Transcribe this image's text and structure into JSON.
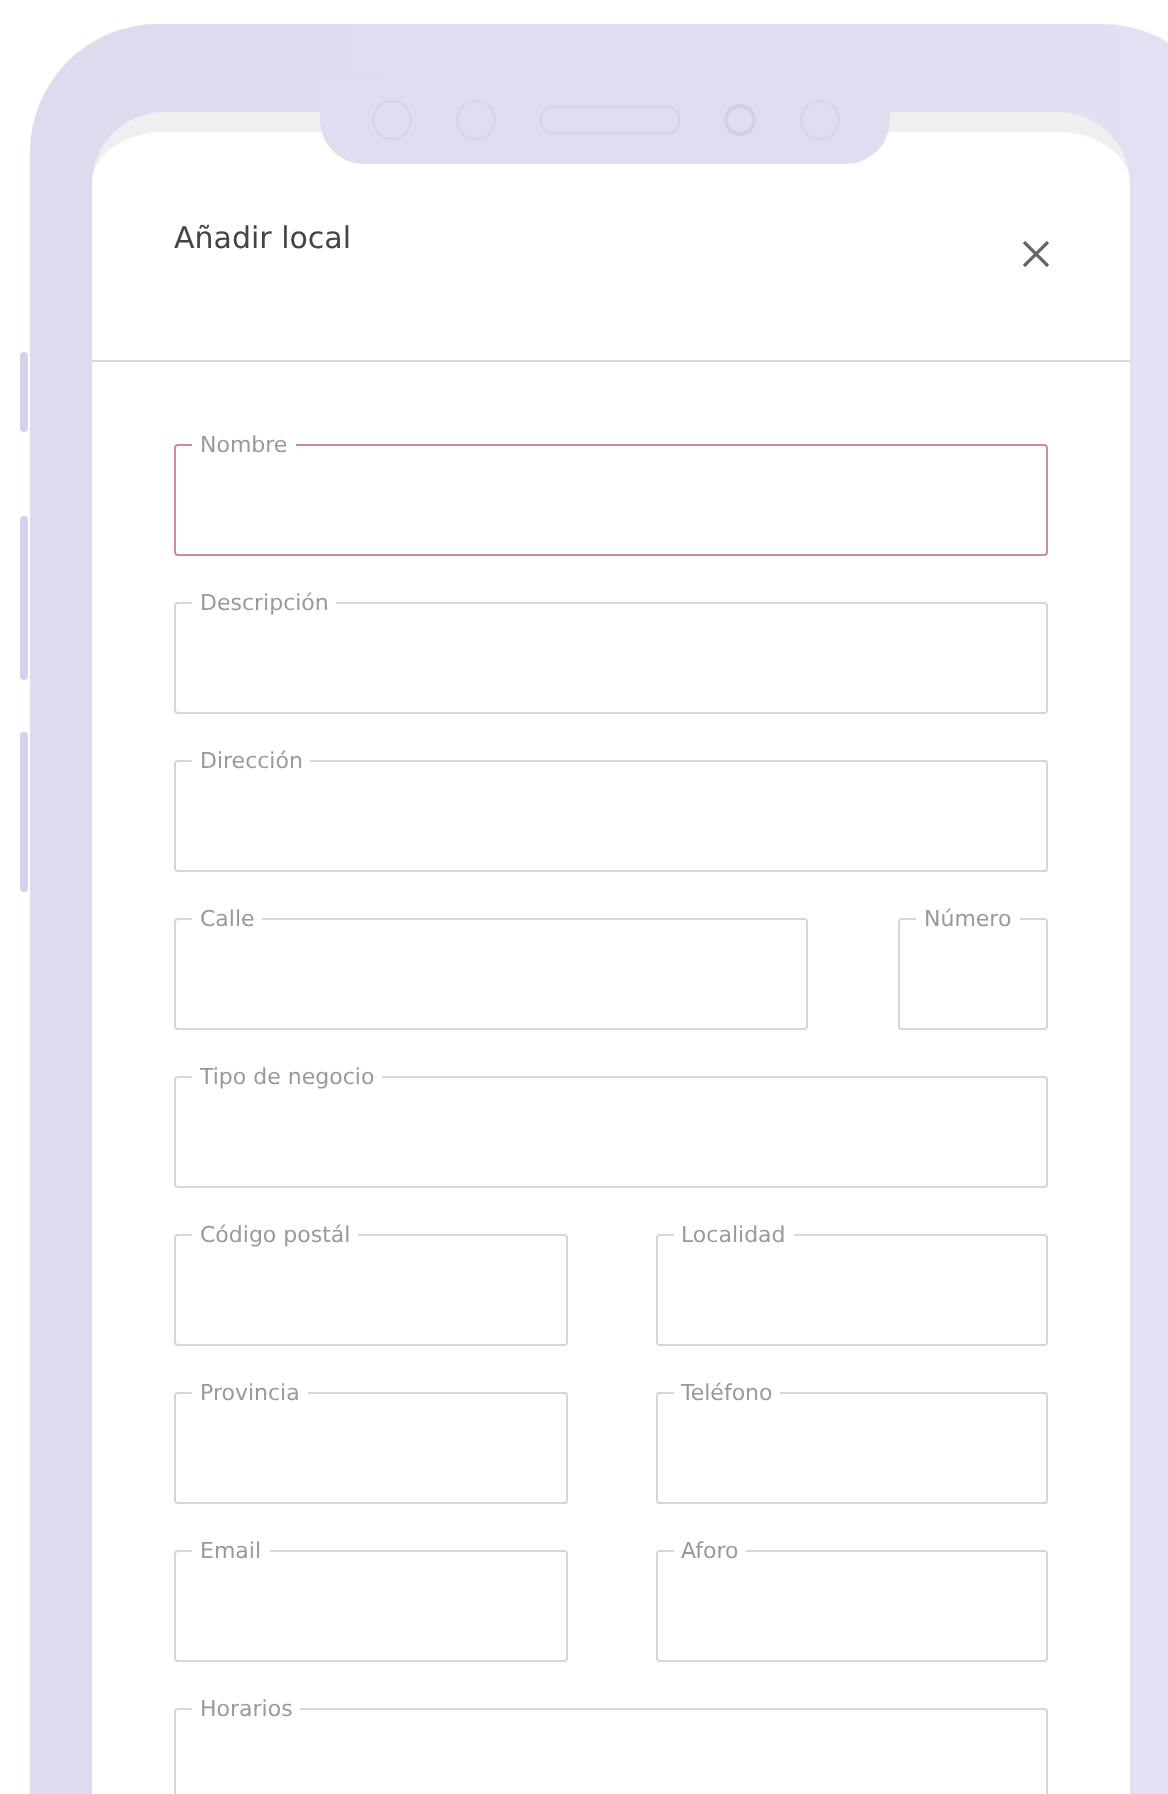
{
  "dialog": {
    "title": "Añadir local"
  },
  "rows": [
    {
      "kind": "single",
      "fields": [
        {
          "label": "Nombre",
          "active": true
        }
      ]
    },
    {
      "kind": "single",
      "fields": [
        {
          "label": "Descripción",
          "active": false
        }
      ]
    },
    {
      "kind": "single",
      "fields": [
        {
          "label": "Dirección",
          "active": false
        }
      ]
    },
    {
      "kind": "street",
      "fields": [
        {
          "label": "Calle",
          "active": false
        },
        {
          "label": "Número",
          "active": false
        }
      ]
    },
    {
      "kind": "single",
      "fields": [
        {
          "label": "Tipo de negocio",
          "active": false
        }
      ]
    },
    {
      "kind": "pair",
      "fields": [
        {
          "label": "Código postál",
          "active": false
        },
        {
          "label": "Localidad",
          "active": false
        }
      ]
    },
    {
      "kind": "pair",
      "fields": [
        {
          "label": "Provincia",
          "active": false
        },
        {
          "label": "Teléfono",
          "active": false
        }
      ]
    },
    {
      "kind": "pair",
      "fields": [
        {
          "label": "Email",
          "active": false
        },
        {
          "label": "Aforo",
          "active": false
        }
      ]
    },
    {
      "kind": "single",
      "fields": [
        {
          "label": "Horarios",
          "active": false
        }
      ]
    }
  ]
}
